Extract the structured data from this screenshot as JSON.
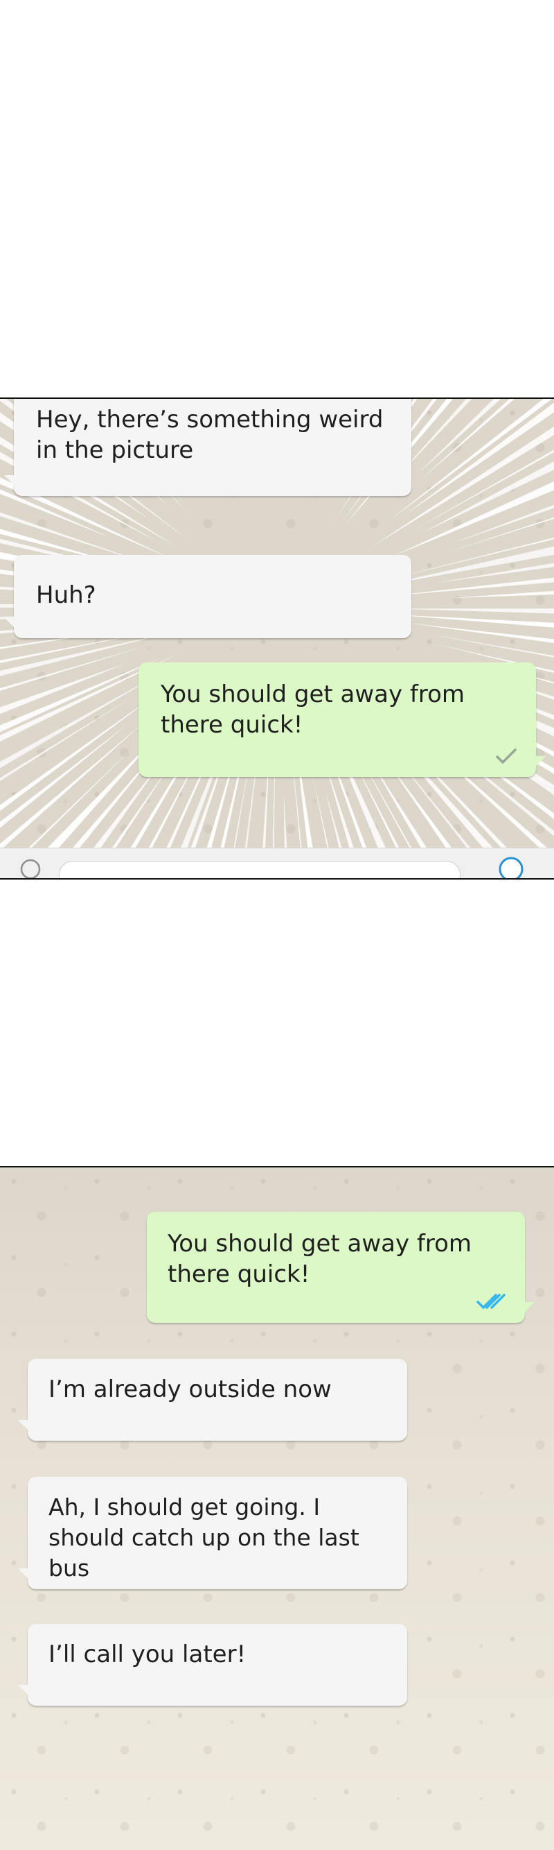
{
  "panel_top": {
    "messages": [
      {
        "direction": "incoming",
        "text": "Hey, there’s something weird in the picture"
      },
      {
        "direction": "incoming",
        "text": "Huh?"
      },
      {
        "direction": "outgoing",
        "text": "You should get away from there quick!",
        "status": "sent"
      }
    ]
  },
  "panel_bottom": {
    "messages": [
      {
        "direction": "outgoing",
        "text": "You should get away from there quick!",
        "status": "read"
      },
      {
        "direction": "incoming",
        "text": "I’m already outside now"
      },
      {
        "direction": "incoming",
        "text": "Ah, I should get going. I should catch up on the last bus"
      },
      {
        "direction": "incoming",
        "text": "I’ll call you later!"
      }
    ]
  },
  "colors": {
    "incoming_bubble": "#f5f5f5",
    "outgoing_bubble": "#dcf8c6",
    "chat_background": "#ddd6cb",
    "sent_tick": "#9aa59a",
    "read_tick": "#34b7f1"
  },
  "icons": {
    "sent_status": "single-check-icon",
    "read_status": "double-check-icon",
    "emoji": "emoji-icon",
    "mic": "mic-icon"
  }
}
